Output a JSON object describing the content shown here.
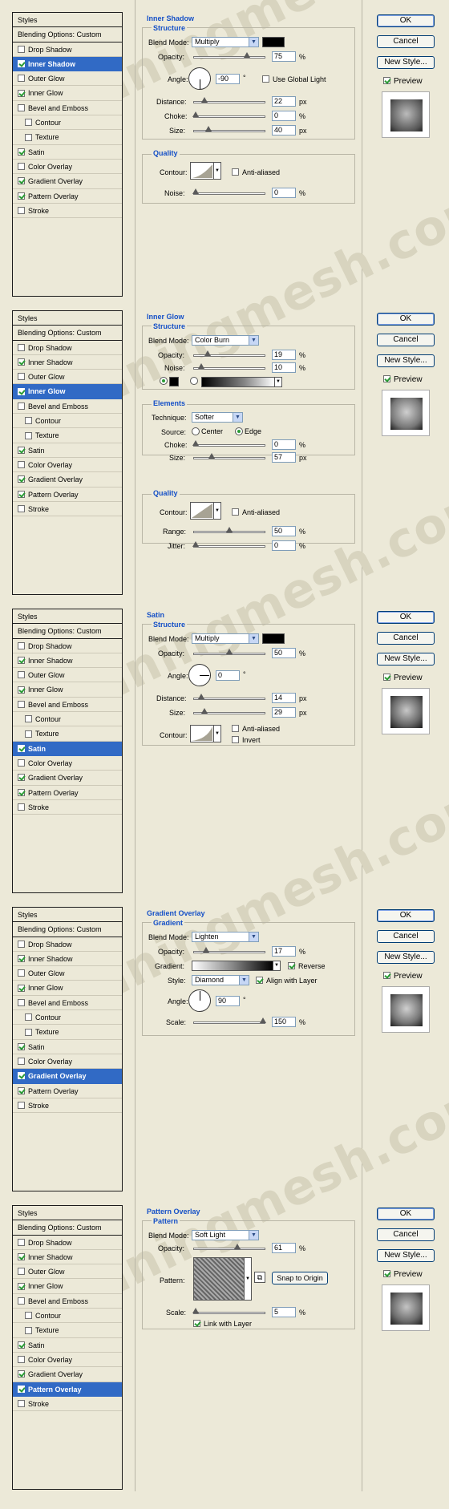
{
  "watermark": "stunningmesh.com",
  "styles_header": "Styles",
  "buttons": {
    "ok": "OK",
    "cancel": "Cancel",
    "new_style": "New Style...",
    "preview": "Preview"
  },
  "style_items": [
    {
      "label": "Blending Options: Custom"
    },
    {
      "label": "Drop Shadow"
    },
    {
      "label": "Inner Shadow"
    },
    {
      "label": "Outer Glow"
    },
    {
      "label": "Inner Glow"
    },
    {
      "label": "Bevel and Emboss"
    },
    {
      "label": "Contour"
    },
    {
      "label": "Texture"
    },
    {
      "label": "Satin"
    },
    {
      "label": "Color Overlay"
    },
    {
      "label": "Gradient Overlay"
    },
    {
      "label": "Pattern Overlay"
    },
    {
      "label": "Stroke"
    }
  ],
  "checked_layers": [
    "Inner Shadow",
    "Inner Glow",
    "Satin",
    "Gradient Overlay",
    "Pattern Overlay"
  ],
  "labels": {
    "blend_mode": "Blend Mode:",
    "opacity": "Opacity:",
    "angle": "Angle:",
    "distance": "Distance:",
    "choke": "Choke:",
    "size": "Size:",
    "contour": "Contour:",
    "noise": "Noise:",
    "anti_aliased": "Anti-aliased",
    "use_global_light": "Use Global Light",
    "technique": "Technique:",
    "source": "Source:",
    "center": "Center",
    "edge": "Edge",
    "range": "Range:",
    "jitter": "Jitter:",
    "invert": "Invert",
    "gradient": "Gradient:",
    "reverse": "Reverse",
    "style": "Style:",
    "align_with_layer": "Align with Layer",
    "scale": "Scale:",
    "pattern": "Pattern:",
    "snap_to_origin": "Snap to Origin",
    "link_with_layer": "Link with Layer",
    "px": "px",
    "percent": "%",
    "degree": "°"
  },
  "d1": {
    "title": "Inner Shadow",
    "structure": "Structure",
    "quality": "Quality",
    "blend_mode": "Multiply",
    "opacity": "75",
    "angle": "-90",
    "distance": "22",
    "choke": "0",
    "size": "40",
    "noise": "0"
  },
  "d2": {
    "title": "Inner Glow",
    "structure": "Structure",
    "elements": "Elements",
    "quality": "Quality",
    "blend_mode": "Color Burn",
    "opacity": "19",
    "noise": "10",
    "technique": "Softer",
    "choke": "0",
    "size": "57",
    "range": "50",
    "jitter": "0"
  },
  "d3": {
    "title": "Satin",
    "structure": "Structure",
    "blend_mode": "Multiply",
    "opacity": "50",
    "angle": "0",
    "distance": "14",
    "size": "29"
  },
  "d4": {
    "title": "Gradient Overlay",
    "section": "Gradient",
    "blend_mode": "Lighten",
    "opacity": "17",
    "style": "Diamond",
    "angle": "90",
    "scale": "150"
  },
  "d5": {
    "title": "Pattern Overlay",
    "section": "Pattern",
    "blend_mode": "Soft Light",
    "opacity": "61",
    "scale": "5"
  }
}
